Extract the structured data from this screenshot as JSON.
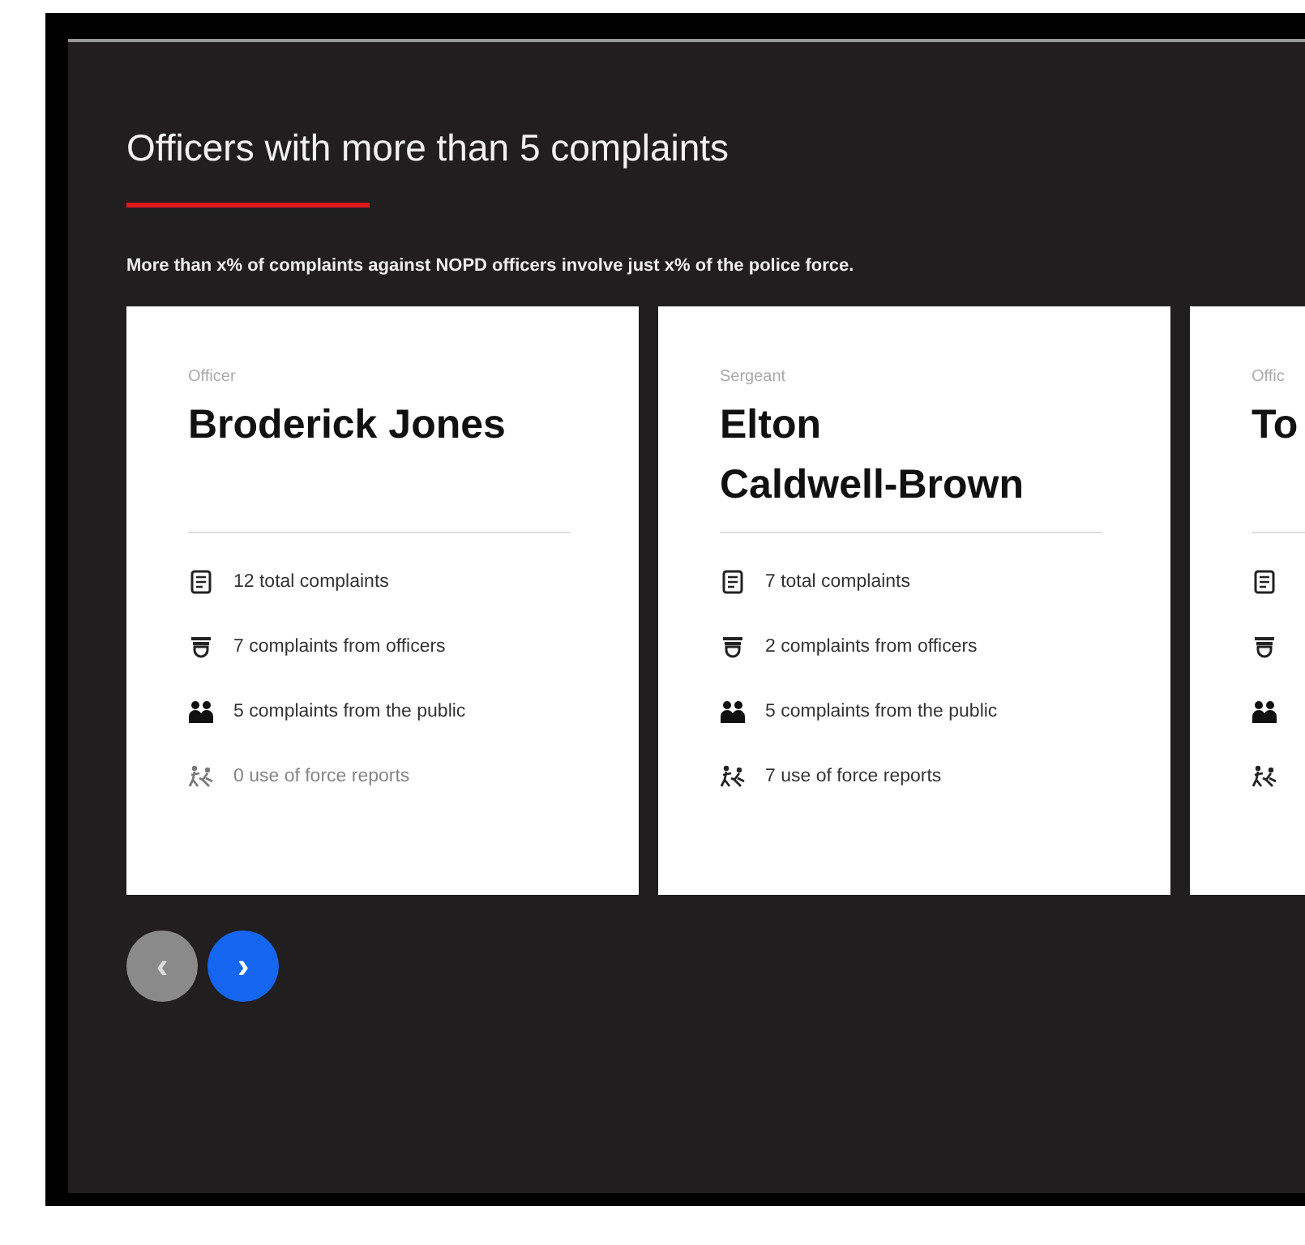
{
  "heading": "Officers with more than 5 complaints",
  "description": "More than x% of complaints against NOPD officers involve just x% of the police force.",
  "cards": [
    {
      "rank": "Officer",
      "name": "Broderick Jones",
      "stats": [
        {
          "kind": "total",
          "text": "12 total complaints",
          "disabled": false
        },
        {
          "kind": "officers",
          "text": "7 complaints from officers",
          "disabled": false
        },
        {
          "kind": "public",
          "text": "5 complaints from the public",
          "disabled": false
        },
        {
          "kind": "force",
          "text": "0 use of force reports",
          "disabled": true
        }
      ]
    },
    {
      "rank": "Sergeant",
      "name": "Elton Caldwell-Brown",
      "stats": [
        {
          "kind": "total",
          "text": "7 total complaints",
          "disabled": false
        },
        {
          "kind": "officers",
          "text": "2 complaints from officers",
          "disabled": false
        },
        {
          "kind": "public",
          "text": "5 complaints from the public",
          "disabled": false
        },
        {
          "kind": "force",
          "text": "7 use of force reports",
          "disabled": false
        }
      ]
    },
    {
      "rank": "Offic",
      "name": "To",
      "stats": [
        {
          "kind": "total",
          "disabled": false
        },
        {
          "kind": "officers",
          "disabled": false
        },
        {
          "kind": "public",
          "disabled": false
        },
        {
          "kind": "force",
          "disabled": false
        }
      ]
    }
  ],
  "nav": [
    {
      "label": "‹",
      "disabled": true
    },
    {
      "label": "›",
      "disabled": false
    }
  ]
}
